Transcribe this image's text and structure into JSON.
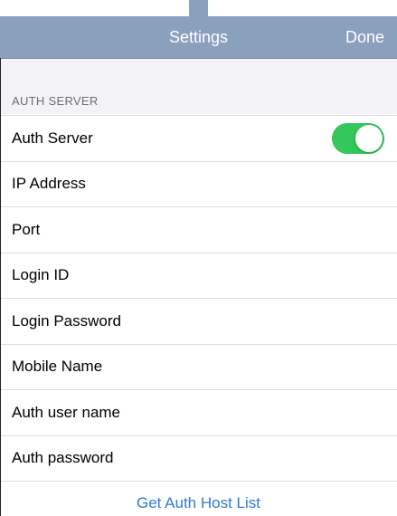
{
  "navbar": {
    "title": "Settings",
    "done_label": "Done"
  },
  "section": {
    "header": "AUTH SERVER"
  },
  "rows": [
    {
      "label": "Auth Server",
      "toggle": true
    },
    {
      "label": "IP Address"
    },
    {
      "label": "Port"
    },
    {
      "label": "Login ID"
    },
    {
      "label": "Login Password"
    },
    {
      "label": "Mobile Name"
    },
    {
      "label": "Auth user name"
    },
    {
      "label": "Auth password"
    }
  ],
  "action": {
    "label": "Get Auth Host List"
  },
  "colors": {
    "navbar": "#8aa0bd",
    "toggle_on": "#34c759",
    "link": "#2f7bd0"
  }
}
